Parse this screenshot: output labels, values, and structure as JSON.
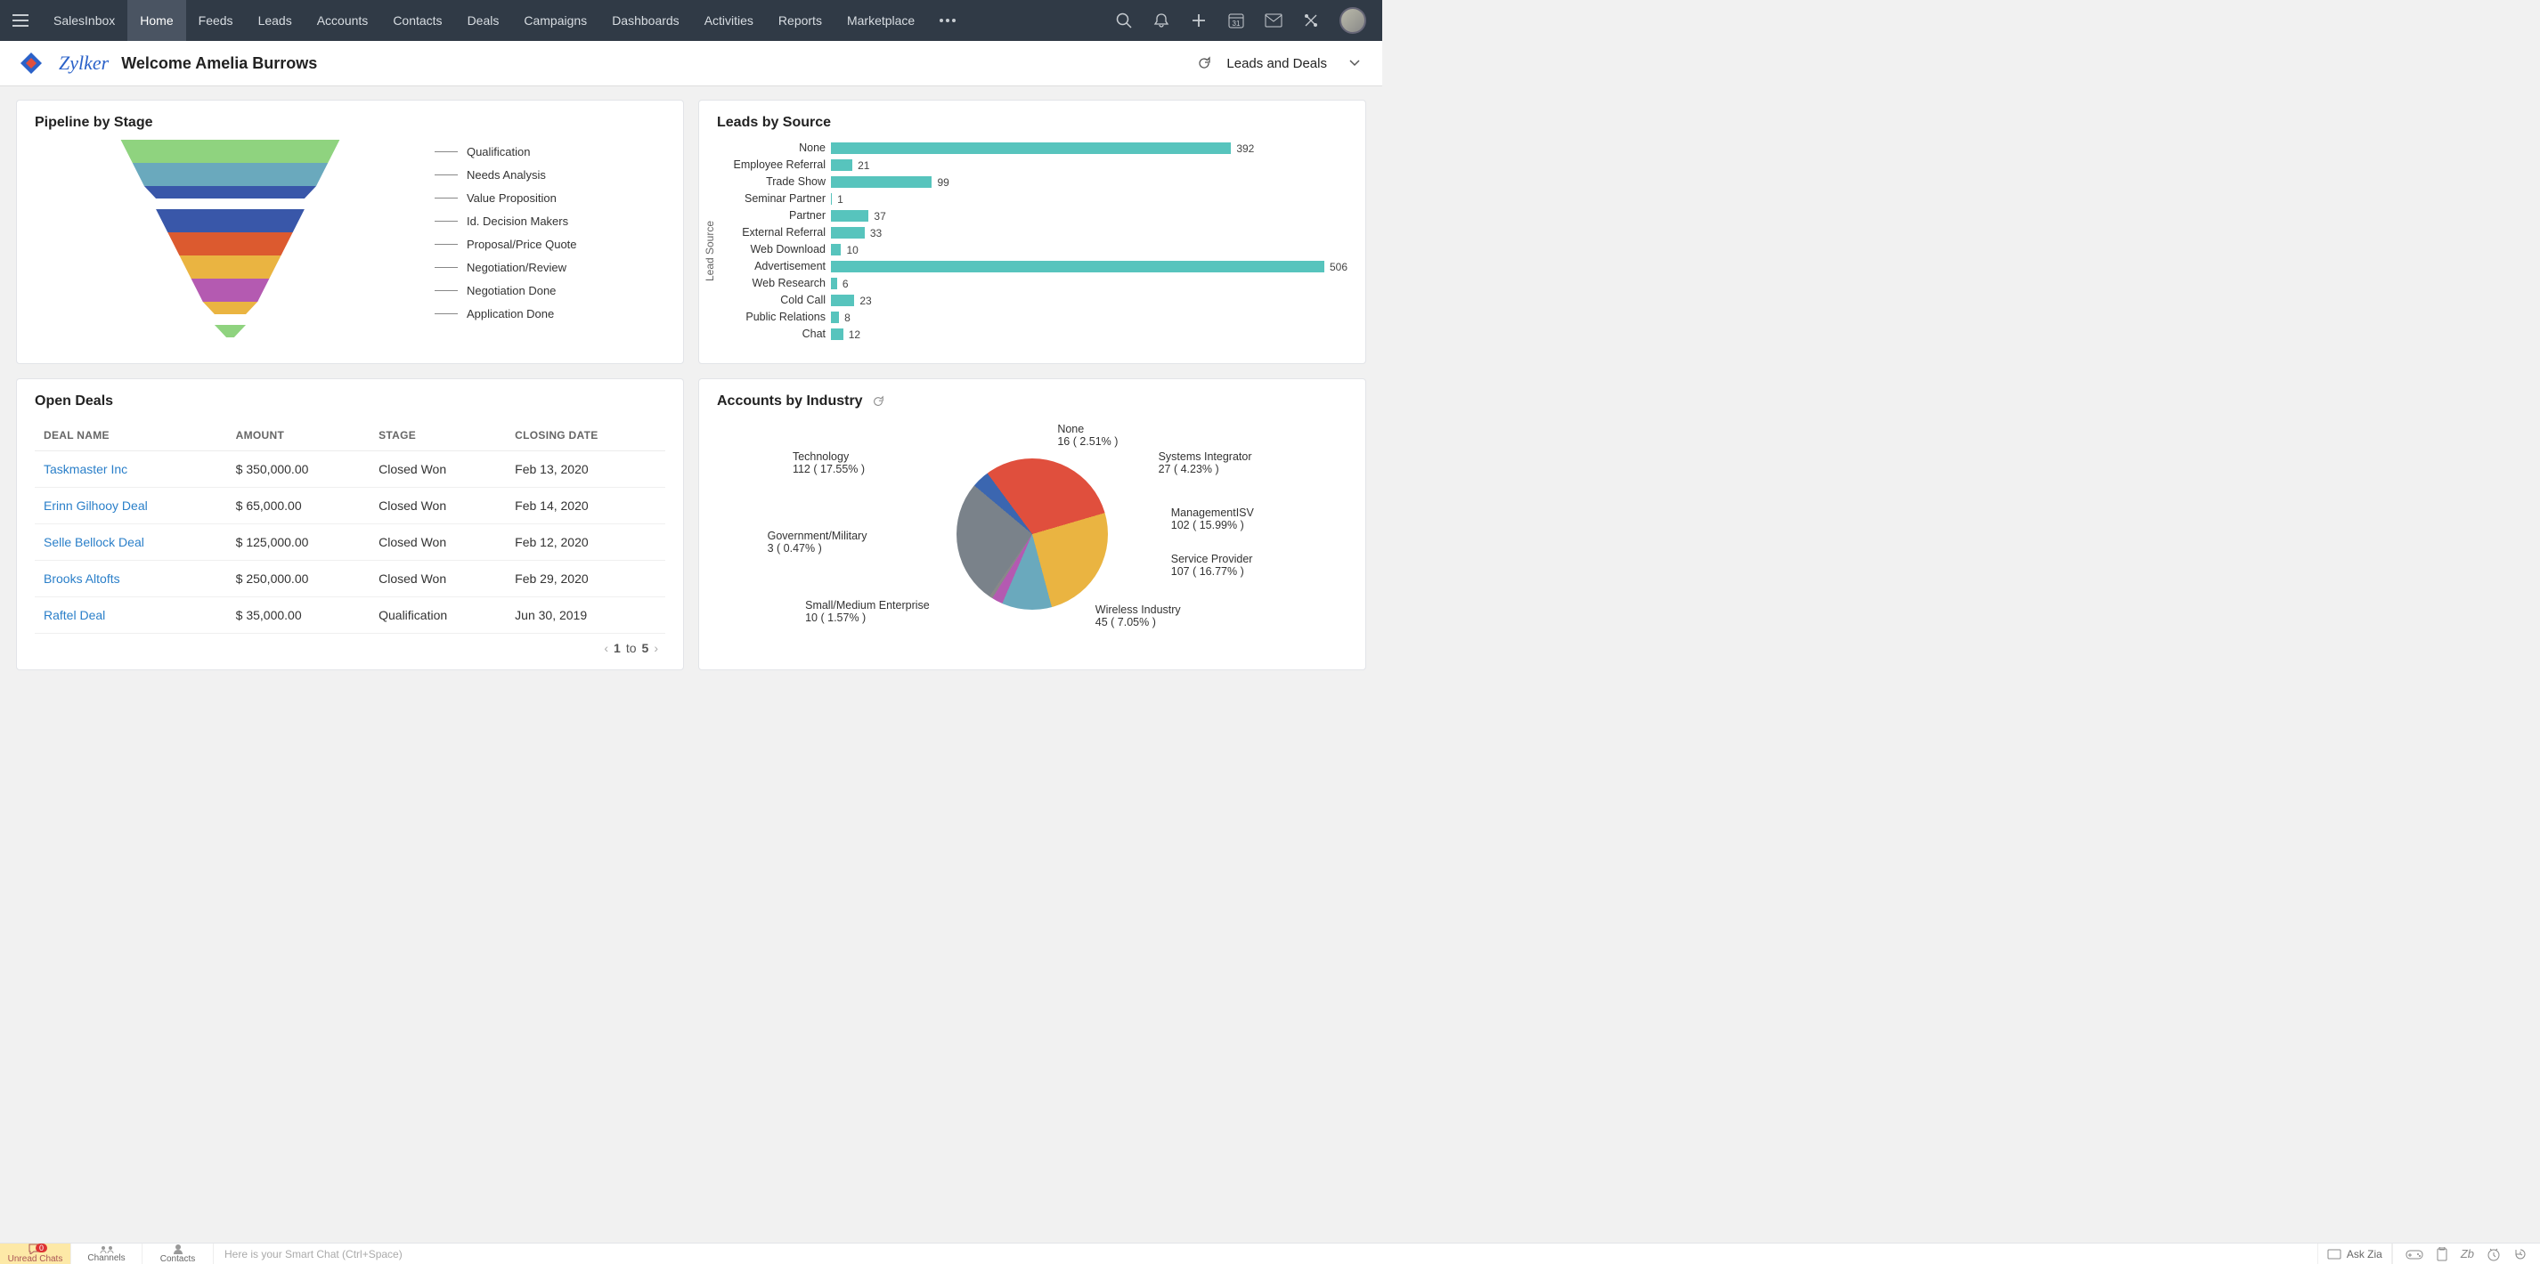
{
  "nav": {
    "items": [
      "SalesInbox",
      "Home",
      "Feeds",
      "Leads",
      "Accounts",
      "Contacts",
      "Deals",
      "Campaigns",
      "Dashboards",
      "Activities",
      "Reports",
      "Marketplace"
    ],
    "active": "Home",
    "calendar_day": "31"
  },
  "subhead": {
    "brand": "Zylker",
    "welcome": "Welcome Amelia Burrows",
    "view": "Leads and Deals"
  },
  "pipeline": {
    "title": "Pipeline by Stage",
    "stages": [
      {
        "label": "Qualification",
        "color": "#8fd37f"
      },
      {
        "label": "Needs Analysis",
        "color": "#6aa9bd"
      },
      {
        "label": "Value Proposition",
        "color": "#3957a9",
        "thin": true
      },
      {
        "label": "Id. Decision Makers",
        "color": "#3957a9"
      },
      {
        "label": "Proposal/Price Quote",
        "color": "#dc5a2f"
      },
      {
        "label": "Negotiation/Review",
        "color": "#eab441"
      },
      {
        "label": "Negotiation Done",
        "color": "#b45ab1"
      },
      {
        "label": "Application Done",
        "color": "#eab441",
        "thin": true
      },
      {
        "label": "",
        "color": "#8fd37f",
        "thin": true
      }
    ]
  },
  "leads": {
    "title": "Leads by Source",
    "ylabel": "Lead Source",
    "rows": [
      {
        "label": "None",
        "value": 392
      },
      {
        "label": "Employee Referral",
        "value": 21
      },
      {
        "label": "Trade Show",
        "value": 99
      },
      {
        "label": "Seminar Partner",
        "value": 1
      },
      {
        "label": "Partner",
        "value": 37
      },
      {
        "label": "External Referral",
        "value": 33
      },
      {
        "label": "Web Download",
        "value": 10
      },
      {
        "label": "Advertisement",
        "value": 506
      },
      {
        "label": "Web Research",
        "value": 6
      },
      {
        "label": "Cold Call",
        "value": 23
      },
      {
        "label": "Public Relations",
        "value": 8
      },
      {
        "label": "Chat",
        "value": 12
      }
    ]
  },
  "open_deals": {
    "title": "Open Deals",
    "columns": [
      "DEAL NAME",
      "AMOUNT",
      "STAGE",
      "CLOSING DATE"
    ],
    "rows": [
      {
        "name": "Taskmaster Inc",
        "amount": "$ 350,000.00",
        "stage": "Closed Won",
        "closing": "Feb 13, 2020"
      },
      {
        "name": "Erinn Gilhooy Deal",
        "amount": "$ 65,000.00",
        "stage": "Closed Won",
        "closing": "Feb 14, 2020"
      },
      {
        "name": "Selle Bellock Deal",
        "amount": "$ 125,000.00",
        "stage": "Closed Won",
        "closing": "Feb 12, 2020"
      },
      {
        "name": "Brooks Altofts",
        "amount": "$ 250,000.00",
        "stage": "Closed Won",
        "closing": "Feb 29, 2020"
      },
      {
        "name": "Raftel Deal",
        "amount": "$ 35,000.00",
        "stage": "Qualification",
        "closing": "Jun 30, 2019"
      }
    ],
    "pager": {
      "from": "1",
      "sep": "to",
      "to": "5"
    }
  },
  "accounts": {
    "title": "Accounts by Industry",
    "slices": [
      {
        "label": "None",
        "count": 16,
        "pct": "2.51%",
        "color": "#3b66b0"
      },
      {
        "label": "Systems Integrator",
        "count": 27,
        "pct": "4.23%",
        "color": "#e04f3d"
      },
      {
        "label": "ManagementISV",
        "count": 102,
        "pct": "15.99%",
        "color": "#e04f3d"
      },
      {
        "label": "Service Provider",
        "count": 107,
        "pct": "16.77%",
        "color": "#eab441"
      },
      {
        "label": "Wireless Industry",
        "count": 45,
        "pct": "7.05%",
        "color": "#6aa9bd"
      },
      {
        "label": "Small/Medium Enterprise",
        "count": 10,
        "pct": "1.57%",
        "color": "#b45ab1"
      },
      {
        "label": "Government/Military",
        "count": 3,
        "pct": "0.47%",
        "color": "#888"
      },
      {
        "label": "Technology",
        "count": 112,
        "pct": "17.55%",
        "color": "#7a828a"
      }
    ]
  },
  "chart_data": [
    {
      "type": "funnel",
      "title": "Pipeline by Stage",
      "categories": [
        "Qualification",
        "Needs Analysis",
        "Value Proposition",
        "Id. Decision Makers",
        "Proposal/Price Quote",
        "Negotiation/Review",
        "Negotiation Done",
        "Application"
      ]
    },
    {
      "type": "bar",
      "title": "Leads by Source",
      "orientation": "horizontal",
      "xlabel": "",
      "ylabel": "Lead Source",
      "categories": [
        "None",
        "Employee Referral",
        "Trade Show",
        "Seminar Partner",
        "Partner",
        "External Referral",
        "Web Download",
        "Advertisement",
        "Web Research",
        "Cold Call",
        "Public Relations",
        "Chat"
      ],
      "values": [
        392,
        21,
        99,
        1,
        37,
        33,
        10,
        506,
        6,
        23,
        8,
        12
      ]
    },
    {
      "type": "pie",
      "title": "Accounts by Industry",
      "series": [
        {
          "name": "Accounts",
          "values": [
            {
              "label": "None",
              "value": 16,
              "pct": 2.51
            },
            {
              "label": "Systems Integrator",
              "value": 27,
              "pct": 4.23
            },
            {
              "label": "ManagementISV",
              "value": 102,
              "pct": 15.99
            },
            {
              "label": "Service Provider",
              "value": 107,
              "pct": 16.77
            },
            {
              "label": "Wireless Industry",
              "value": 45,
              "pct": 7.05
            },
            {
              "label": "Small/Medium Enterprise",
              "value": 10,
              "pct": 1.57
            },
            {
              "label": "Government/Military",
              "value": 3,
              "pct": 0.47
            },
            {
              "label": "Technology",
              "value": 112,
              "pct": 17.55
            }
          ]
        }
      ]
    }
  ],
  "bottombar": {
    "unread": "Unread Chats",
    "unread_badge": "0",
    "channels": "Channels",
    "contacts": "Contacts",
    "smart_chat": "Here is your Smart Chat (Ctrl+Space)",
    "ask_zia": "Ask Zia"
  }
}
